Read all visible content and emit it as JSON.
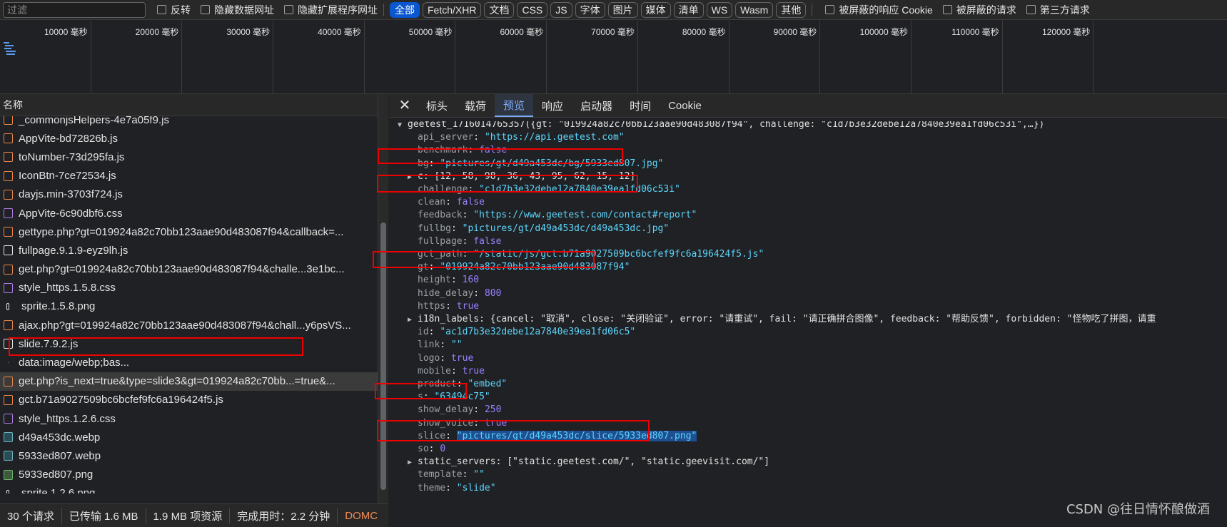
{
  "filterbar": {
    "placeholder": "过滤",
    "checkboxes": [
      "反转",
      "隐藏数据网址",
      "隐藏扩展程序网址"
    ],
    "types": [
      "全部",
      "Fetch/XHR",
      "文档",
      "CSS",
      "JS",
      "字体",
      "图片",
      "媒体",
      "清单",
      "WS",
      "Wasm",
      "其他"
    ],
    "active_type": "全部",
    "checkboxes_right": [
      "被屏蔽的响应 Cookie",
      "被屏蔽的请求",
      "第三方请求"
    ]
  },
  "timeline": {
    "ticks": [
      "10000 毫秒",
      "20000 毫秒",
      "30000 毫秒",
      "40000 毫秒",
      "50000 毫秒",
      "60000 毫秒",
      "70000 毫秒",
      "80000 毫秒",
      "90000 毫秒",
      "100000 毫秒",
      "110000 毫秒",
      "120000 毫秒"
    ]
  },
  "list": {
    "header": "名称",
    "rows": [
      {
        "name": "_commonjsHelpers-4e7a05f9.js",
        "icon": "js-file-icon"
      },
      {
        "name": "AppVite-bd72826b.js",
        "icon": "js-file-icon"
      },
      {
        "name": "toNumber-73d295fa.js",
        "icon": "js-file-icon"
      },
      {
        "name": "IconBtn-7ce72534.js",
        "icon": "js-file-icon"
      },
      {
        "name": "dayjs.min-3703f724.js",
        "icon": "js-file-icon"
      },
      {
        "name": "AppVite-6c90dbf6.css",
        "icon": "css-file-icon"
      },
      {
        "name": "gettype.php?gt=019924a82c70bb123aae90d483087f94&callback=...",
        "icon": "js-file-icon"
      },
      {
        "name": "fullpage.9.1.9-eyz9lh.js",
        "icon": "doc-file-icon"
      },
      {
        "name": "get.php?gt=019924a82c70bb123aae90d483087f94&challe...3e1bc...",
        "icon": "js-file-icon"
      },
      {
        "name": "style_https.1.5.8.css",
        "icon": "css-file-icon"
      },
      {
        "name": "sprite.1.5.8.png",
        "icon": "small-image-icon"
      },
      {
        "name": "ajax.php?gt=019924a82c70bb123aae90d483087f94&chall...y6psVS...",
        "icon": "js-file-icon"
      },
      {
        "name": "slide.7.9.2.js",
        "icon": "doc-file-icon"
      },
      {
        "name": "data:image/webp;bas...",
        "icon": "dot-icon"
      },
      {
        "name": "get.php?is_next=true&type=slide3&gt=019924a82c70bb...=true&...",
        "icon": "js-file-icon",
        "selected": true
      },
      {
        "name": "gct.b71a9027509bc6bcfef9fc6a196424f5.js",
        "icon": "js-file-icon"
      },
      {
        "name": "style_https.1.2.6.css",
        "icon": "css-file-icon"
      },
      {
        "name": "d49a453dc.webp",
        "icon": "image-file-icon"
      },
      {
        "name": "5933ed807.webp",
        "icon": "image-file-icon"
      },
      {
        "name": "5933ed807.png",
        "icon": "png-file-icon"
      },
      {
        "name": "sprite.1.2.6.png",
        "icon": "small-image-icon"
      }
    ]
  },
  "status": {
    "requests": "30 个请求",
    "transferred": "已传输 1.6 MB",
    "resources": "1.9 MB 项资源",
    "finish": "完成用时：2.2 分钟",
    "dom": "DOMC"
  },
  "tabs": [
    "标头",
    "载荷",
    "预览",
    "响应",
    "启动器",
    "时间",
    "Cookie"
  ],
  "active_tab": "预览",
  "preview": {
    "root": "geetest_1716014765357({gt: \"019924a82c70bb123aae90d483087f94\", challenge: \"c1d7b3e32debe12a7840e39ea1fd06c53i\",…})",
    "lines": [
      {
        "key": "api_server",
        "val": "\"https://api.geetest.com\"",
        "t": "s"
      },
      {
        "key": "benchmark",
        "val": "false",
        "t": "b"
      },
      {
        "key": "bg",
        "val": "\"pictures/gt/d49a453dc/bg/5933ed807.jpg\"",
        "t": "s"
      },
      {
        "key": "c",
        "val": "[12, 58, 98, 36, 43, 95, 62, 15, 12]",
        "t": "p",
        "expand": true
      },
      {
        "key": "challenge",
        "val": "\"c1d7b3e32debe12a7840e39ea1fd06c53i\"",
        "t": "s"
      },
      {
        "key": "clean",
        "val": "false",
        "t": "b"
      },
      {
        "key": "feedback",
        "val": "\"https://www.geetest.com/contact#report\"",
        "t": "s"
      },
      {
        "key": "fullbg",
        "val": "\"pictures/gt/d49a453dc/d49a453dc.jpg\"",
        "t": "s"
      },
      {
        "key": "fullpage",
        "val": "false",
        "t": "b"
      },
      {
        "key": "gct_path",
        "val": "\"/static/js/gct.b71a9027509bc6bcfef9fc6a196424f5.js\"",
        "t": "s"
      },
      {
        "key": "gt",
        "val": "\"019924a82c70bb123aae90d483087f94\"",
        "t": "s"
      },
      {
        "key": "height",
        "val": "160",
        "t": "n"
      },
      {
        "key": "hide_delay",
        "val": "800",
        "t": "n"
      },
      {
        "key": "https",
        "val": "true",
        "t": "b"
      },
      {
        "key": "i18n_labels",
        "val": "{cancel: \"取消\", close: \"关闭验证\", error: \"请重试\", fail: \"请正确拼合图像\", feedback: \"帮助反馈\", forbidden: \"怪物吃了拼图，请重",
        "t": "p",
        "expand": true
      },
      {
        "key": "id",
        "val": "\"ac1d7b3e32debe12a7840e39ea1fd06c5\"",
        "t": "s"
      },
      {
        "key": "link",
        "val": "\"\"",
        "t": "s"
      },
      {
        "key": "logo",
        "val": "true",
        "t": "b"
      },
      {
        "key": "mobile",
        "val": "true",
        "t": "b"
      },
      {
        "key": "product",
        "val": "\"embed\"",
        "t": "s"
      },
      {
        "key": "s",
        "val": "\"63494c75\"",
        "t": "s"
      },
      {
        "key": "show_delay",
        "val": "250",
        "t": "n"
      },
      {
        "key": "show_voice",
        "val": "true",
        "t": "b"
      },
      {
        "key": "slice",
        "val": "\"pictures/gt/d49a453dc/slice/5933ed807.png\"",
        "t": "s",
        "highlight": true
      },
      {
        "key": "so",
        "val": "0",
        "t": "n"
      },
      {
        "key": "static_servers",
        "val": "[\"static.geetest.com/\", \"static.geevisit.com/\"]",
        "t": "p",
        "expand": true
      },
      {
        "key": "template",
        "val": "\"\"",
        "t": "s"
      },
      {
        "key": "theme",
        "val": "\"slide\"",
        "t": "s"
      }
    ]
  },
  "watermark": "CSDN @往日情怀酿做酒"
}
